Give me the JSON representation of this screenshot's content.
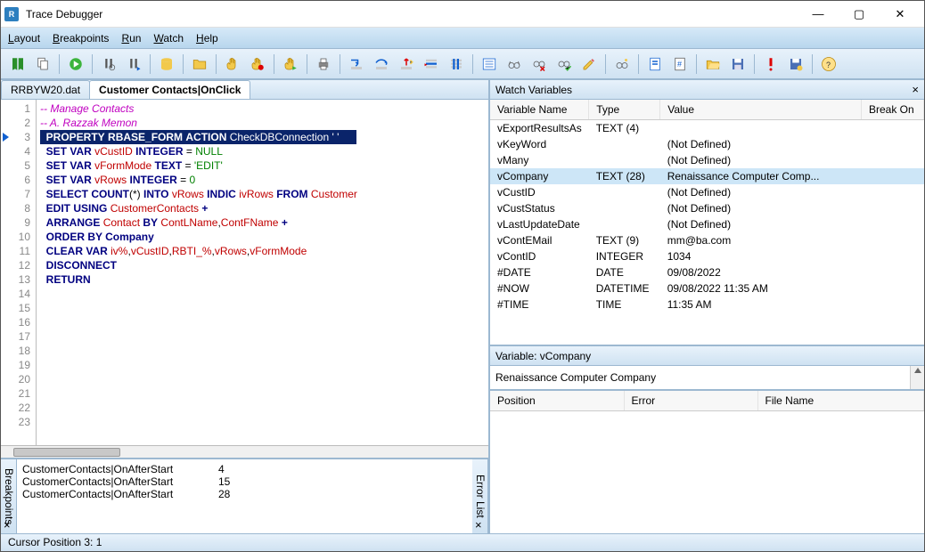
{
  "window": {
    "title": "Trace Debugger",
    "app_icon_letter": "R"
  },
  "menu": {
    "layout": "Layout",
    "breakpoints": "Breakpoints",
    "run": "Run",
    "watch": "Watch",
    "help": "Help"
  },
  "tabs": {
    "file": "RRBYW20.dat",
    "active": "Customer Contacts|OnClick"
  },
  "code": {
    "lines": [
      {
        "n": 1,
        "html": "<span class='c-cmt'>-- Manage Contacts</span>"
      },
      {
        "n": 2,
        "html": "<span class='c-cmt'>-- A. Razzak Memon</span>"
      },
      {
        "n": 3,
        "current": true,
        "html": "<span class='sel'>  <b>PROPERTY</b> <b>RBASE_FORM</b> <b>ACTION</b> CheckDBConnection ' '      </span>"
      },
      {
        "n": 4,
        "html": "  <span class='c-kw'>SET VAR</span> <span class='c-id'>vCustID</span> <span class='c-kw'>INTEGER</span> = <span class='c-lit'>NULL</span>"
      },
      {
        "n": 5,
        "html": "  <span class='c-kw'>SET VAR</span> <span class='c-id'>vFormMode</span> <span class='c-kw'>TEXT</span> = <span class='c-lit'>'EDIT'</span>"
      },
      {
        "n": 6,
        "html": "  <span class='c-kw'>SET VAR</span> <span class='c-id'>vRows</span> <span class='c-kw'>INTEGER</span> = <span class='c-lit'>0</span>"
      },
      {
        "n": 7,
        "html": "  <span class='c-kw'>SELECT COUNT</span>(*) <span class='c-kw'>INTO</span> <span class='c-id'>vRows</span> <span class='c-kw'>INDIC</span> <span class='c-id'>ivRows</span> <span class='c-kw'>FROM</span> <span class='c-id'>Customer</span>"
      },
      {
        "n": 8,
        "html": "  <span class='c-kw'>EDIT USING</span> <span class='c-id'>CustomerContacts</span> <span class='c-kw'>+</span>"
      },
      {
        "n": 9,
        "html": "  <span class='c-kw'>ARRANGE</span> <span class='c-id'>Contact</span> <span class='c-kw'>BY</span> <span class='c-id'>ContLName</span>,<span class='c-id'>ContFName</span> <span class='c-kw'>+</span>"
      },
      {
        "n": 10,
        "html": "  <span class='c-kw'>ORDER BY Company</span>"
      },
      {
        "n": 11,
        "html": "  <span class='c-kw'>CLEAR VAR</span> <span class='c-id'>iv%</span>,<span class='c-id'>vCustID</span>,<span class='c-id'>RBTI_%</span>,<span class='c-id'>vRows</span>,<span class='c-id'>vFormMode</span>"
      },
      {
        "n": 12,
        "html": "  <span class='c-kw'>DISCONNECT</span>"
      },
      {
        "n": 13,
        "html": "  <span class='c-kw'>RETURN</span>"
      },
      {
        "n": 14,
        "html": ""
      },
      {
        "n": 15,
        "html": ""
      },
      {
        "n": 16,
        "html": ""
      },
      {
        "n": 17,
        "html": ""
      },
      {
        "n": 18,
        "html": ""
      },
      {
        "n": 19,
        "html": ""
      },
      {
        "n": 20,
        "html": ""
      },
      {
        "n": 21,
        "html": ""
      },
      {
        "n": 22,
        "html": ""
      },
      {
        "n": 23,
        "html": ""
      }
    ]
  },
  "breakpoints": {
    "label": "Breakpoints",
    "rows": [
      {
        "name": "CustomerContacts|OnAfterStart",
        "line": "4"
      },
      {
        "name": "CustomerContacts|OnAfterStart",
        "line": "15"
      },
      {
        "name": "CustomerContacts|OnAfterStart",
        "line": "28"
      }
    ]
  },
  "errorlist": {
    "label": "Error List"
  },
  "watch": {
    "title": "Watch Variables",
    "cols": {
      "name": "Variable Name",
      "type": "Type",
      "value": "Value",
      "break": "Break On"
    },
    "rows": [
      {
        "name": "vExportResultsAs",
        "type": "TEXT (4)",
        "value": ""
      },
      {
        "name": "vKeyWord",
        "type": "",
        "value": "(Not Defined)"
      },
      {
        "name": "vMany",
        "type": "",
        "value": "(Not Defined)"
      },
      {
        "name": "vCompany",
        "type": "TEXT (28)",
        "value": "Renaissance Computer Comp...",
        "sel": true
      },
      {
        "name": "vCustID",
        "type": "",
        "value": "(Not Defined)"
      },
      {
        "name": "vCustStatus",
        "type": "",
        "value": "(Not Defined)"
      },
      {
        "name": "vLastUpdateDate",
        "type": "",
        "value": "(Not Defined)"
      },
      {
        "name": "vContEMail",
        "type": "TEXT (9)",
        "value": "mm@ba.com"
      },
      {
        "name": "vContID",
        "type": "INTEGER",
        "value": "1034"
      },
      {
        "name": "#DATE",
        "type": "DATE",
        "value": "09/08/2022"
      },
      {
        "name": "#NOW",
        "type": "DATETIME",
        "value": "09/08/2022 11:35 AM"
      },
      {
        "name": "#TIME",
        "type": "TIME",
        "value": "11:35 AM"
      }
    ]
  },
  "var_detail": {
    "label": "Variable: vCompany",
    "value": "Renaissance Computer Company"
  },
  "errors": {
    "cols": {
      "pos": "Position",
      "err": "Error",
      "file": "File Name"
    }
  },
  "status": {
    "text": "Cursor Position 3: 1"
  }
}
